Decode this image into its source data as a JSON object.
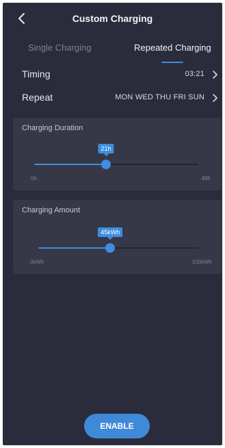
{
  "header": {
    "title": "Custom Charging"
  },
  "tabs": [
    {
      "label": "Single Charging",
      "active": false
    },
    {
      "label": "Repeated Charging",
      "active": true
    }
  ],
  "timing": {
    "label": "Timing",
    "value": "03:21"
  },
  "repeat": {
    "label": "Repeat",
    "value": "MON WED THU FRI SUN"
  },
  "charging_duration": {
    "title": "Charging Duration",
    "value_label": "21h",
    "min_label": "0h",
    "max_label": "48h",
    "value": 21,
    "min": 0,
    "max": 48
  },
  "charging_amount": {
    "title": "Charging Amount",
    "value_label": "45kWh",
    "min_label": "0kWh",
    "max_label": "100kWh",
    "value": 45,
    "min": 0,
    "max": 100
  },
  "enable_button": {
    "label": "ENABLE"
  },
  "colors": {
    "background": "#2b2c3b",
    "card": "#363848",
    "accent": "#3d8de0",
    "muted_text": "#7d8095"
  }
}
